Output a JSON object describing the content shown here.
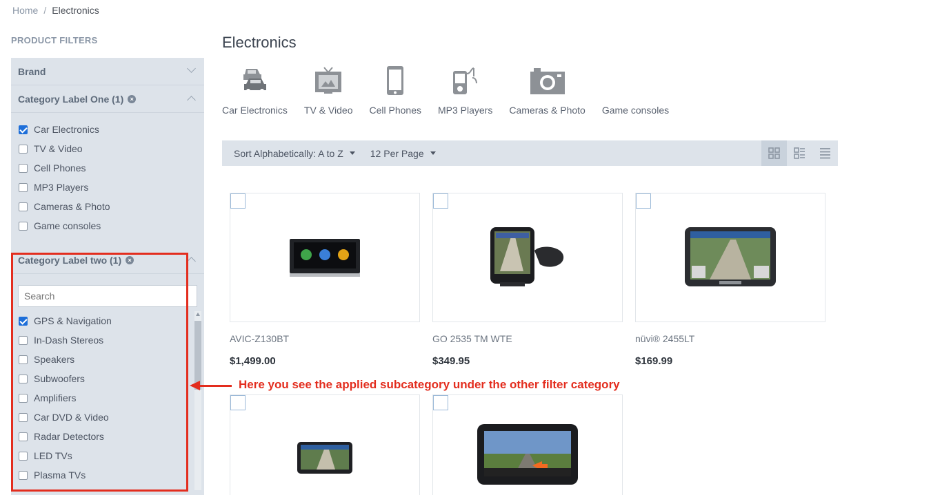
{
  "breadcrumb": {
    "home": "Home",
    "separator": "/",
    "current": "Electronics"
  },
  "sidebar": {
    "title": "PRODUCT FILTERS",
    "brand": {
      "label": "Brand"
    },
    "category_one": {
      "label": "Category Label One (1)",
      "items": [
        {
          "label": "Car Electronics",
          "checked": true
        },
        {
          "label": "TV & Video",
          "checked": false
        },
        {
          "label": "Cell Phones",
          "checked": false
        },
        {
          "label": "MP3 Players",
          "checked": false
        },
        {
          "label": "Cameras & Photo",
          "checked": false
        },
        {
          "label": "Game consoles",
          "checked": false
        }
      ]
    },
    "category_two": {
      "label": "Category Label two (1)",
      "search_placeholder": "Search",
      "items": [
        {
          "label": "GPS & Navigation",
          "checked": true
        },
        {
          "label": "In-Dash Stereos",
          "checked": false
        },
        {
          "label": "Speakers",
          "checked": false
        },
        {
          "label": "Subwoofers",
          "checked": false
        },
        {
          "label": "Amplifiers",
          "checked": false
        },
        {
          "label": "Car DVD & Video",
          "checked": false
        },
        {
          "label": "Radar Detectors",
          "checked": false
        },
        {
          "label": "LED TVs",
          "checked": false
        },
        {
          "label": "Plasma TVs",
          "checked": false
        }
      ]
    }
  },
  "main": {
    "title": "Electronics",
    "categories": [
      {
        "label": "Car Electronics",
        "icon": "car-icon"
      },
      {
        "label": "TV & Video",
        "icon": "tv-icon"
      },
      {
        "label": "Cell Phones",
        "icon": "phone-icon"
      },
      {
        "label": "MP3 Players",
        "icon": "mp3-player-icon"
      },
      {
        "label": "Cameras & Photo",
        "icon": "camera-icon"
      },
      {
        "label": "Game consoles",
        "icon": "game-console-icon"
      }
    ],
    "toolbar": {
      "sort_label": "Sort Alphabetically: A to Z",
      "per_page_label": "12 Per Page",
      "views": [
        "grid-large-view-icon",
        "grid-list-view-icon",
        "list-view-icon"
      ]
    },
    "products": [
      {
        "name": "AVIC-Z130BT",
        "price": "$1,499.00"
      },
      {
        "name": "GO 2535 TM WTE",
        "price": "$349.95"
      },
      {
        "name": "nüvi® 2455LT",
        "price": "$169.99"
      },
      {
        "name": "",
        "price": ""
      },
      {
        "name": "",
        "price": ""
      }
    ]
  },
  "annotation": {
    "text": "Here you see the applied subcategory under the other filter category"
  },
  "colors": {
    "accent": "#1e6fd9",
    "annotation": "#e32d1e",
    "panel": "#dde3ea"
  }
}
